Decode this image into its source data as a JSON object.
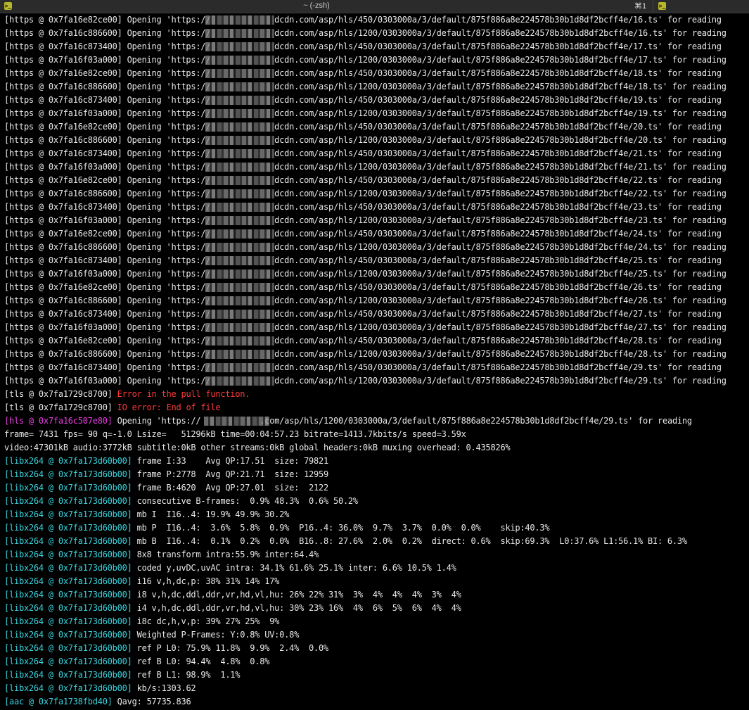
{
  "window": {
    "title": "~ (-zsh)",
    "shortcut": "⌘1",
    "tab_icon_glyph": ">_"
  },
  "colors": {
    "background": "#000000",
    "text": "#e8e8e8",
    "cyan": "#39d3dd",
    "magenta": "#e63fe0",
    "red": "#ff3a3a"
  },
  "terminal": {
    "lines": [
      {
        "segments": [
          {
            "text": "[https @ 0x7fa16e82ce00] Opening 'https://",
            "color": "default"
          },
          {
            "text": "             ",
            "color": "default"
          },
          {
            "text": "dcdn.com/asp/hls/450/0303000a/3/default/875f886a8e224578b30b1d8df2bcff4e/16.ts' for reading",
            "color": "default"
          }
        ],
        "redacted": true
      },
      {
        "segments": [
          {
            "text": "[https @ 0x7fa16c886600] Opening 'https://",
            "color": "default"
          },
          {
            "text": "             ",
            "color": "default"
          },
          {
            "text": "dcdn.com/asp/hls/1200/0303000a/3/default/875f886a8e224578b30b1d8df2bcff4e/16.ts' for reading",
            "color": "default"
          }
        ],
        "redacted": true
      },
      {
        "segments": [
          {
            "text": "[https @ 0x7fa16c873400] Opening 'https://",
            "color": "default"
          },
          {
            "text": "             ",
            "color": "default"
          },
          {
            "text": "dcdn.com/asp/hls/450/0303000a/3/default/875f886a8e224578b30b1d8df2bcff4e/17.ts' for reading",
            "color": "default"
          }
        ],
        "redacted": true
      },
      {
        "segments": [
          {
            "text": "[https @ 0x7fa16f03a000] Opening 'https://",
            "color": "default"
          },
          {
            "text": "             ",
            "color": "default"
          },
          {
            "text": "dcdn.com/asp/hls/1200/0303000a/3/default/875f886a8e224578b30b1d8df2bcff4e/17.ts' for reading",
            "color": "default"
          }
        ],
        "redacted": true
      },
      {
        "segments": [
          {
            "text": "[https @ 0x7fa16e82ce00] Opening 'https://",
            "color": "default"
          },
          {
            "text": "             ",
            "color": "default"
          },
          {
            "text": "dcdn.com/asp/hls/450/0303000a/3/default/875f886a8e224578b30b1d8df2bcff4e/18.ts' for reading",
            "color": "default"
          }
        ],
        "redacted": true
      },
      {
        "segments": [
          {
            "text": "[https @ 0x7fa16c886600] Opening 'https://",
            "color": "default"
          },
          {
            "text": "             ",
            "color": "default"
          },
          {
            "text": "dcdn.com/asp/hls/1200/0303000a/3/default/875f886a8e224578b30b1d8df2bcff4e/18.ts' for reading",
            "color": "default"
          }
        ],
        "redacted": true
      },
      {
        "segments": [
          {
            "text": "[https @ 0x7fa16c873400] Opening 'https://",
            "color": "default"
          },
          {
            "text": "             ",
            "color": "default"
          },
          {
            "text": "dcdn.com/asp/hls/450/0303000a/3/default/875f886a8e224578b30b1d8df2bcff4e/19.ts' for reading",
            "color": "default"
          }
        ],
        "redacted": true
      },
      {
        "segments": [
          {
            "text": "[https @ 0x7fa16f03a000] Opening 'https://",
            "color": "default"
          },
          {
            "text": "             ",
            "color": "default"
          },
          {
            "text": "dcdn.com/asp/hls/1200/0303000a/3/default/875f886a8e224578b30b1d8df2bcff4e/19.ts' for reading",
            "color": "default"
          }
        ],
        "redacted": true
      },
      {
        "segments": [
          {
            "text": "[https @ 0x7fa16e82ce00] Opening 'https://",
            "color": "default"
          },
          {
            "text": "             ",
            "color": "default"
          },
          {
            "text": "dcdn.com/asp/hls/450/0303000a/3/default/875f886a8e224578b30b1d8df2bcff4e/20.ts' for reading",
            "color": "default"
          }
        ],
        "redacted": true
      },
      {
        "segments": [
          {
            "text": "[https @ 0x7fa16c886600] Opening 'https://",
            "color": "default"
          },
          {
            "text": "             ",
            "color": "default"
          },
          {
            "text": "dcdn.com/asp/hls/1200/0303000a/3/default/875f886a8e224578b30b1d8df2bcff4e/20.ts' for reading",
            "color": "default"
          }
        ],
        "redacted": true
      },
      {
        "segments": [
          {
            "text": "[https @ 0x7fa16c873400] Opening 'https://",
            "color": "default"
          },
          {
            "text": "             ",
            "color": "default"
          },
          {
            "text": "dcdn.com/asp/hls/450/0303000a/3/default/875f886a8e224578b30b1d8df2bcff4e/21.ts' for reading",
            "color": "default"
          }
        ],
        "redacted": true
      },
      {
        "segments": [
          {
            "text": "[https @ 0x7fa16f03a000] Opening 'https://",
            "color": "default"
          },
          {
            "text": "             ",
            "color": "default"
          },
          {
            "text": "dcdn.com/asp/hls/1200/0303000a/3/default/875f886a8e224578b30b1d8df2bcff4e/21.ts' for reading",
            "color": "default"
          }
        ],
        "redacted": true
      },
      {
        "segments": [
          {
            "text": "[https @ 0x7fa16e82ce00] Opening 'https://",
            "color": "default"
          },
          {
            "text": "             ",
            "color": "default"
          },
          {
            "text": "dcdn.com/asp/hls/450/0303000a/3/default/875f886a8e224578b30b1d8df2bcff4e/22.ts' for reading",
            "color": "default"
          }
        ],
        "redacted": true
      },
      {
        "segments": [
          {
            "text": "[https @ 0x7fa16c886600] Opening 'https://",
            "color": "default"
          },
          {
            "text": "             ",
            "color": "default"
          },
          {
            "text": "dcdn.com/asp/hls/1200/0303000a/3/default/875f886a8e224578b30b1d8df2bcff4e/22.ts' for reading",
            "color": "default"
          }
        ],
        "redacted": true
      },
      {
        "segments": [
          {
            "text": "[https @ 0x7fa16c873400] Opening 'https://",
            "color": "default"
          },
          {
            "text": "             ",
            "color": "default"
          },
          {
            "text": "dcdn.com/asp/hls/450/0303000a/3/default/875f886a8e224578b30b1d8df2bcff4e/23.ts' for reading",
            "color": "default"
          }
        ],
        "redacted": true
      },
      {
        "segments": [
          {
            "text": "[https @ 0x7fa16f03a000] Opening 'https://",
            "color": "default"
          },
          {
            "text": "             ",
            "color": "default"
          },
          {
            "text": "dcdn.com/asp/hls/1200/0303000a/3/default/875f886a8e224578b30b1d8df2bcff4e/23.ts' for reading",
            "color": "default"
          }
        ],
        "redacted": true
      },
      {
        "segments": [
          {
            "text": "[https @ 0x7fa16e82ce00] Opening 'https://",
            "color": "default"
          },
          {
            "text": "             ",
            "color": "default"
          },
          {
            "text": "dcdn.com/asp/hls/450/0303000a/3/default/875f886a8e224578b30b1d8df2bcff4e/24.ts' for reading",
            "color": "default"
          }
        ],
        "redacted": true
      },
      {
        "segments": [
          {
            "text": "[https @ 0x7fa16c886600] Opening 'https://",
            "color": "default"
          },
          {
            "text": "             ",
            "color": "default"
          },
          {
            "text": "dcdn.com/asp/hls/1200/0303000a/3/default/875f886a8e224578b30b1d8df2bcff4e/24.ts' for reading",
            "color": "default"
          }
        ],
        "redacted": true
      },
      {
        "segments": [
          {
            "text": "[https @ 0x7fa16c873400] Opening 'https://",
            "color": "default"
          },
          {
            "text": "             ",
            "color": "default"
          },
          {
            "text": "dcdn.com/asp/hls/450/0303000a/3/default/875f886a8e224578b30b1d8df2bcff4e/25.ts' for reading",
            "color": "default"
          }
        ],
        "redacted": true
      },
      {
        "segments": [
          {
            "text": "[https @ 0x7fa16f03a000] Opening 'https://",
            "color": "default"
          },
          {
            "text": "             ",
            "color": "default"
          },
          {
            "text": "dcdn.com/asp/hls/1200/0303000a/3/default/875f886a8e224578b30b1d8df2bcff4e/25.ts' for reading",
            "color": "default"
          }
        ],
        "redacted": true
      },
      {
        "segments": [
          {
            "text": "[https @ 0x7fa16e82ce00] Opening 'https://",
            "color": "default"
          },
          {
            "text": "             ",
            "color": "default"
          },
          {
            "text": "dcdn.com/asp/hls/450/0303000a/3/default/875f886a8e224578b30b1d8df2bcff4e/26.ts' for reading",
            "color": "default"
          }
        ],
        "redacted": true
      },
      {
        "segments": [
          {
            "text": "[https @ 0x7fa16c886600] Opening 'https://",
            "color": "default"
          },
          {
            "text": "             ",
            "color": "default"
          },
          {
            "text": "dcdn.com/asp/hls/1200/0303000a/3/default/875f886a8e224578b30b1d8df2bcff4e/26.ts' for reading",
            "color": "default"
          }
        ],
        "redacted": true
      },
      {
        "segments": [
          {
            "text": "[https @ 0x7fa16c873400] Opening 'https://",
            "color": "default"
          },
          {
            "text": "             ",
            "color": "default"
          },
          {
            "text": "dcdn.com/asp/hls/450/0303000a/3/default/875f886a8e224578b30b1d8df2bcff4e/27.ts' for reading",
            "color": "default"
          }
        ],
        "redacted": true
      },
      {
        "segments": [
          {
            "text": "[https @ 0x7fa16f03a000] Opening 'https://",
            "color": "default"
          },
          {
            "text": "             ",
            "color": "default"
          },
          {
            "text": "dcdn.com/asp/hls/1200/0303000a/3/default/875f886a8e224578b30b1d8df2bcff4e/27.ts' for reading",
            "color": "default"
          }
        ],
        "redacted": true
      },
      {
        "segments": [
          {
            "text": "[https @ 0x7fa16e82ce00] Opening 'https://",
            "color": "default"
          },
          {
            "text": "             ",
            "color": "default"
          },
          {
            "text": "dcdn.com/asp/hls/450/0303000a/3/default/875f886a8e224578b30b1d8df2bcff4e/28.ts' for reading",
            "color": "default"
          }
        ],
        "redacted": true
      },
      {
        "segments": [
          {
            "text": "[https @ 0x7fa16c886600] Opening 'https://",
            "color": "default"
          },
          {
            "text": "             ",
            "color": "default"
          },
          {
            "text": "dcdn.com/asp/hls/1200/0303000a/3/default/875f886a8e224578b30b1d8df2bcff4e/28.ts' for reading",
            "color": "default"
          }
        ],
        "redacted": true
      },
      {
        "segments": [
          {
            "text": "[https @ 0x7fa16c873400] Opening 'https://",
            "color": "default"
          },
          {
            "text": "             ",
            "color": "default"
          },
          {
            "text": "dcdn.com/asp/hls/450/0303000a/3/default/875f886a8e224578b30b1d8df2bcff4e/29.ts' for reading",
            "color": "default"
          }
        ],
        "redacted": true
      },
      {
        "segments": [
          {
            "text": "[https @ 0x7fa16f03a000] Opening 'https://",
            "color": "default"
          },
          {
            "text": "             ",
            "color": "default"
          },
          {
            "text": "dcdn.com/asp/hls/1200/0303000a/3/default/875f886a8e224578b30b1d8df2bcff4e/29.ts' for reading",
            "color": "default"
          }
        ],
        "redacted": true
      },
      {
        "segments": [
          {
            "text": "[tls @ 0x7fa1729c8700] ",
            "color": "default"
          },
          {
            "text": "Error in the pull function.",
            "color": "red"
          }
        ]
      },
      {
        "segments": [
          {
            "text": "[tls @ 0x7fa1729c8700] ",
            "color": "default"
          },
          {
            "text": "IO error: End of file",
            "color": "red"
          }
        ]
      },
      {
        "segments": [
          {
            "text": "[hls @ 0x7fa16c507e80]",
            "color": "magenta"
          },
          {
            "text": " Opening 'https://",
            "color": "default"
          },
          {
            "text": "            ",
            "color": "default"
          },
          {
            "text": ".com/asp/hls/1200/0303000a/3/default/875f886a8e224578b30b1d8df2bcff4e/29.ts' for reading",
            "color": "default"
          }
        ],
        "redacted": true,
        "redact_style": "hls"
      },
      {
        "segments": [
          {
            "text": "frame= 7431 fps= 90 q=-1.0 Lsize=   51296kB time=00:04:57.23 bitrate=1413.7kbits/s speed=3.59x",
            "color": "default"
          }
        ]
      },
      {
        "segments": [
          {
            "text": "video:47301kB audio:3772kB subtitle:0kB other streams:0kB global headers:0kB muxing overhead: 0.435826%",
            "color": "default"
          }
        ]
      },
      {
        "segments": [
          {
            "text": "[libx264 @ 0x7fa173d60b00]",
            "color": "cyan"
          },
          {
            "text": " frame I:33    Avg QP:17.51  size: 79821",
            "color": "default"
          }
        ]
      },
      {
        "segments": [
          {
            "text": "[libx264 @ 0x7fa173d60b00]",
            "color": "cyan"
          },
          {
            "text": " frame P:2778  Avg QP:21.71  size: 12959",
            "color": "default"
          }
        ]
      },
      {
        "segments": [
          {
            "text": "[libx264 @ 0x7fa173d60b00]",
            "color": "cyan"
          },
          {
            "text": " frame B:4620  Avg QP:27.01  size:  2122",
            "color": "default"
          }
        ]
      },
      {
        "segments": [
          {
            "text": "[libx264 @ 0x7fa173d60b00]",
            "color": "cyan"
          },
          {
            "text": " consecutive B-frames:  0.9% 48.3%  0.6% 50.2%",
            "color": "default"
          }
        ]
      },
      {
        "segments": [
          {
            "text": "[libx264 @ 0x7fa173d60b00]",
            "color": "cyan"
          },
          {
            "text": " mb I  I16..4: 19.9% 49.9% 30.2%",
            "color": "default"
          }
        ]
      },
      {
        "segments": [
          {
            "text": "[libx264 @ 0x7fa173d60b00]",
            "color": "cyan"
          },
          {
            "text": " mb P  I16..4:  3.6%  5.8%  0.9%  P16..4: 36.0%  9.7%  3.7%  0.0%  0.0%    skip:40.3%",
            "color": "default"
          }
        ]
      },
      {
        "segments": [
          {
            "text": "[libx264 @ 0x7fa173d60b00]",
            "color": "cyan"
          },
          {
            "text": " mb B  I16..4:  0.1%  0.2%  0.0%  B16..8: 27.6%  2.0%  0.2%  direct: 0.6%  skip:69.3%  L0:37.6% L1:56.1% BI: 6.3%",
            "color": "default"
          }
        ]
      },
      {
        "segments": [
          {
            "text": "[libx264 @ 0x7fa173d60b00]",
            "color": "cyan"
          },
          {
            "text": " 8x8 transform intra:55.9% inter:64.4%",
            "color": "default"
          }
        ]
      },
      {
        "segments": [
          {
            "text": "[libx264 @ 0x7fa173d60b00]",
            "color": "cyan"
          },
          {
            "text": " coded y,uvDC,uvAC intra: 34.1% 61.6% 25.1% inter: 6.6% 10.5% 1.4%",
            "color": "default"
          }
        ]
      },
      {
        "segments": [
          {
            "text": "[libx264 @ 0x7fa173d60b00]",
            "color": "cyan"
          },
          {
            "text": " i16 v,h,dc,p: 38% 31% 14% 17%",
            "color": "default"
          }
        ]
      },
      {
        "segments": [
          {
            "text": "[libx264 @ 0x7fa173d60b00]",
            "color": "cyan"
          },
          {
            "text": " i8 v,h,dc,ddl,ddr,vr,hd,vl,hu: 26% 22% 31%  3%  4%  4%  4%  3%  4%",
            "color": "default"
          }
        ]
      },
      {
        "segments": [
          {
            "text": "[libx264 @ 0x7fa173d60b00]",
            "color": "cyan"
          },
          {
            "text": " i4 v,h,dc,ddl,ddr,vr,hd,vl,hu: 30% 23% 16%  4%  6%  5%  6%  4%  4%",
            "color": "default"
          }
        ]
      },
      {
        "segments": [
          {
            "text": "[libx264 @ 0x7fa173d60b00]",
            "color": "cyan"
          },
          {
            "text": " i8c dc,h,v,p: 39% 27% 25%  9%",
            "color": "default"
          }
        ]
      },
      {
        "segments": [
          {
            "text": "[libx264 @ 0x7fa173d60b00]",
            "color": "cyan"
          },
          {
            "text": " Weighted P-Frames: Y:0.8% UV:0.8%",
            "color": "default"
          }
        ]
      },
      {
        "segments": [
          {
            "text": "[libx264 @ 0x7fa173d60b00]",
            "color": "cyan"
          },
          {
            "text": " ref P L0: 75.9% 11.8%  9.9%  2.4%  0.0%",
            "color": "default"
          }
        ]
      },
      {
        "segments": [
          {
            "text": "[libx264 @ 0x7fa173d60b00]",
            "color": "cyan"
          },
          {
            "text": " ref B L0: 94.4%  4.8%  0.8%",
            "color": "default"
          }
        ]
      },
      {
        "segments": [
          {
            "text": "[libx264 @ 0x7fa173d60b00]",
            "color": "cyan"
          },
          {
            "text": " ref B L1: 98.9%  1.1%",
            "color": "default"
          }
        ]
      },
      {
        "segments": [
          {
            "text": "[libx264 @ 0x7fa173d60b00]",
            "color": "cyan"
          },
          {
            "text": " kb/s:1303.62",
            "color": "default"
          }
        ]
      },
      {
        "segments": [
          {
            "text": "[aac @ 0x7fa1738fbd40]",
            "color": "cyan"
          },
          {
            "text": " Qavg: 57735.836",
            "color": "default"
          }
        ]
      }
    ]
  }
}
